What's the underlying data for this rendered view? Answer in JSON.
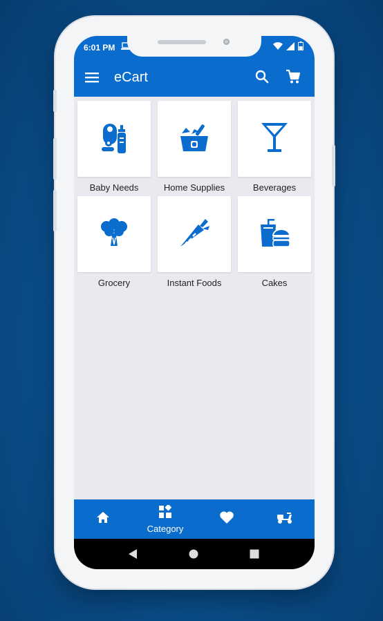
{
  "status_bar": {
    "time": "6:01 PM"
  },
  "app_bar": {
    "title": "eCart"
  },
  "categories": [
    {
      "label": "Baby Needs",
      "icon": "baby-bottle-bib-icon"
    },
    {
      "label": "Home Supplies",
      "icon": "mortar-pestle-basket-icon"
    },
    {
      "label": "Beverages",
      "icon": "cocktail-glass-icon"
    },
    {
      "label": "Grocery",
      "icon": "broccoli-icon"
    },
    {
      "label": "Instant Foods",
      "icon": "carrot-icon"
    },
    {
      "label": "Cakes",
      "icon": "burger-drink-icon"
    }
  ],
  "bottom_nav": {
    "items": [
      {
        "icon": "home-icon"
      },
      {
        "icon": "category-icon",
        "label": "Category"
      },
      {
        "icon": "heart-icon"
      },
      {
        "icon": "scooter-icon"
      }
    ]
  },
  "colors": {
    "primary": "#0a6ccc",
    "background": "#e9e9ef",
    "tile": "#ffffff"
  }
}
